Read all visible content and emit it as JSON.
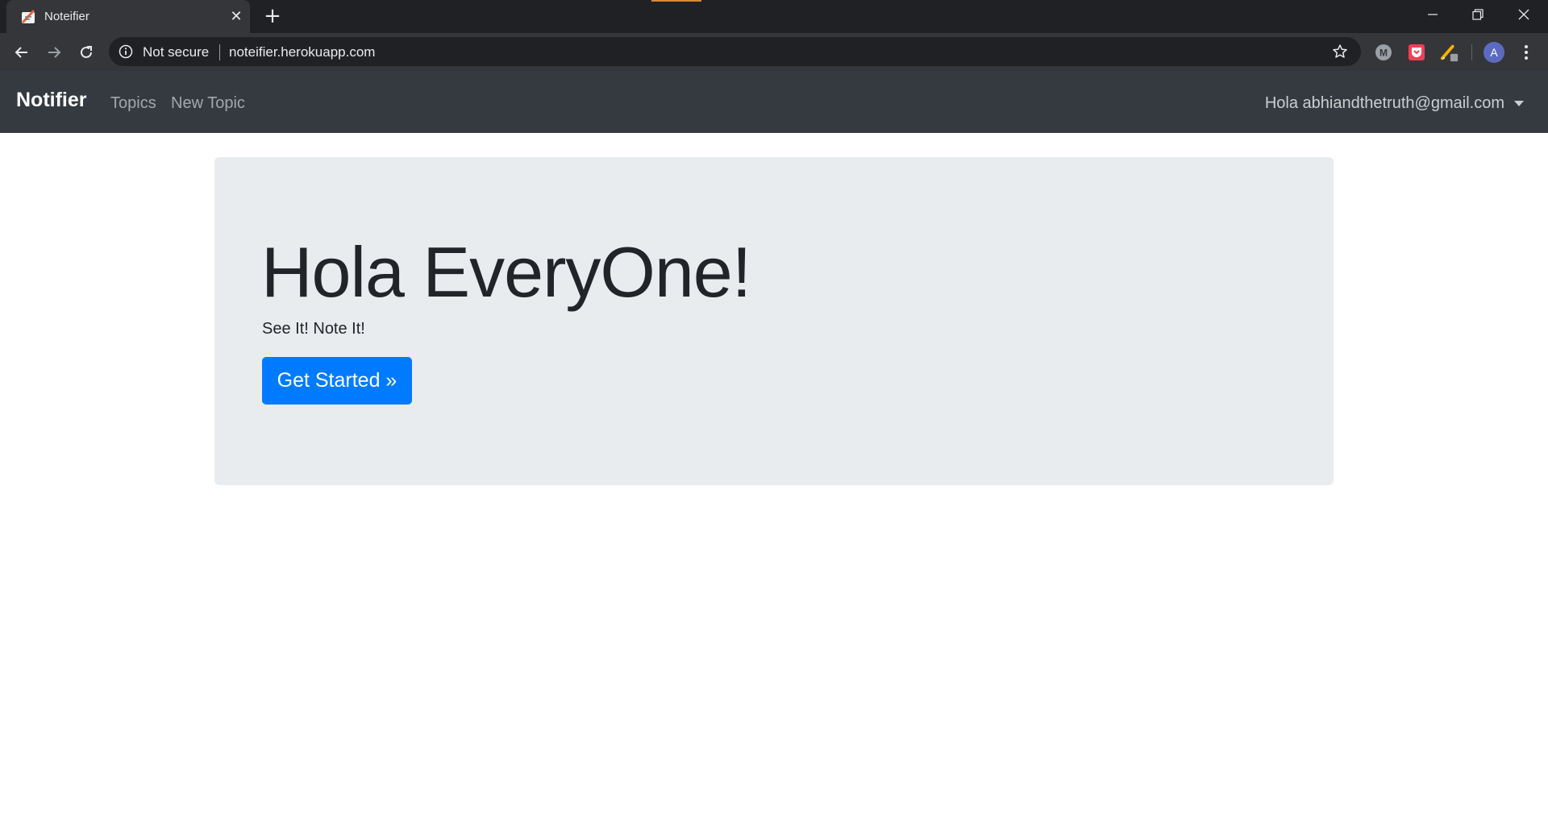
{
  "browser": {
    "tab_title": "Noteifier",
    "security_label": "Not secure",
    "url": "noteifier.herokuapp.com",
    "avatar_letter": "A"
  },
  "navbar": {
    "brand": "Notifier",
    "links": [
      "Topics",
      "New Topic"
    ],
    "user_menu": "Hola abhiandthetruth@gmail.com"
  },
  "hero": {
    "heading": "Hola EveryOne!",
    "tagline": "See It! Note It!",
    "button": "Get Started »"
  },
  "colors": {
    "navbar_bg": "#343a40",
    "hero_bg": "#e9ecef",
    "primary": "#007bff"
  }
}
